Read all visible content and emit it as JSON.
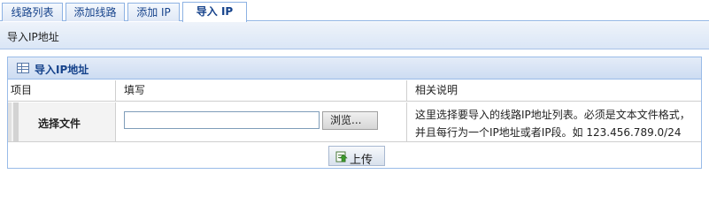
{
  "tabs": [
    "线路列表",
    "添加线路",
    "添加 IP",
    "导入 IP"
  ],
  "active_tab": "导入 IP",
  "page_title": "导入IP地址",
  "panel": {
    "title": "导入IP地址",
    "icon": "table-icon",
    "columns": [
      "项目",
      "填写",
      "相关说明"
    ],
    "row": {
      "label": "选择文件",
      "file_value": "",
      "browse_label": "浏览...",
      "description_line1": "这里选择要导入的线路IP地址列表。必须是文本文件格式，",
      "description_line2": "并且每行为一个IP地址或者IP段。如 123.456.789.0/24"
    }
  },
  "upload_button": {
    "label": "上传",
    "icon": "upload-icon"
  },
  "colors": {
    "tab_text": "#15428b",
    "border_blue": "#99bbe8",
    "header_bg": "#dae6f6"
  }
}
